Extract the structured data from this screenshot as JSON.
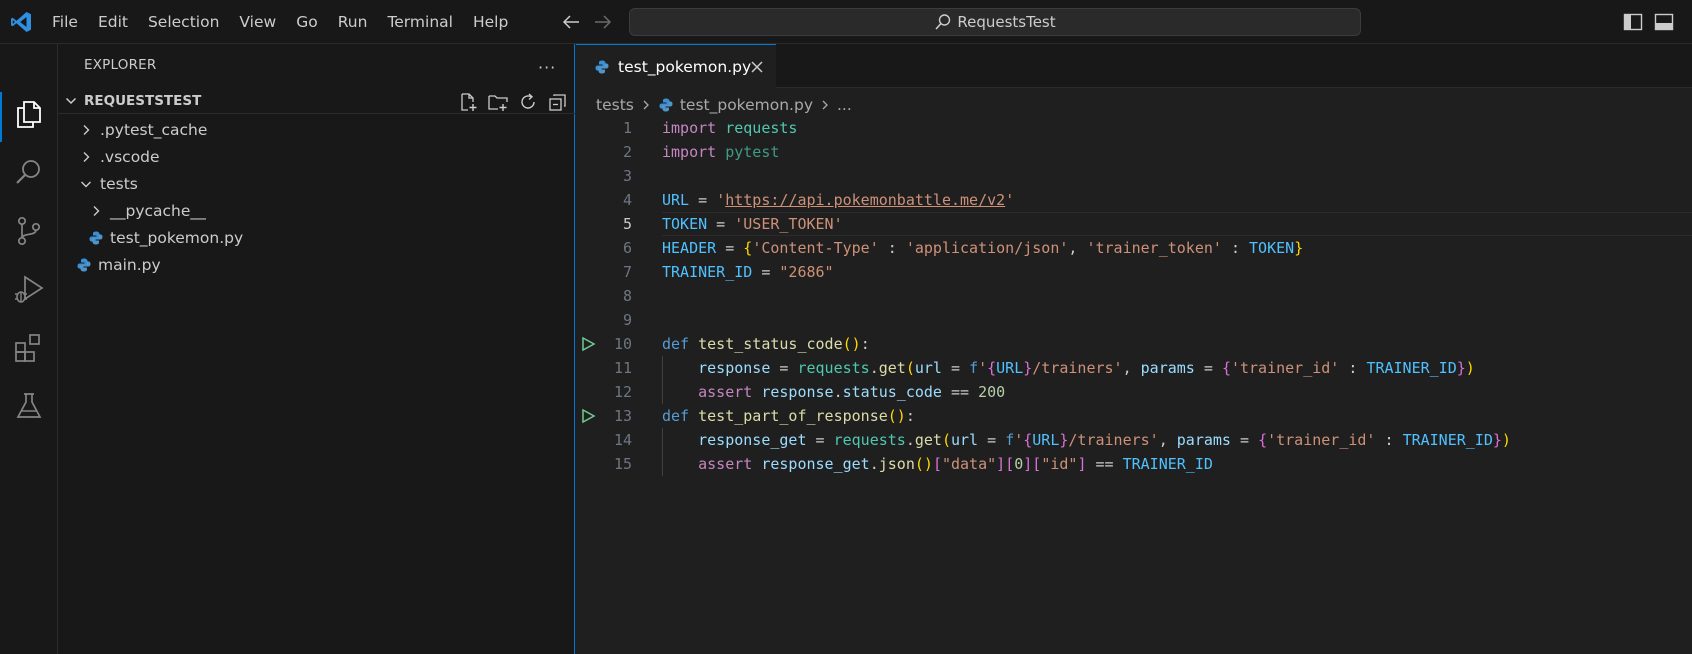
{
  "titlebar": {
    "menu": [
      "File",
      "Edit",
      "Selection",
      "View",
      "Go",
      "Run",
      "Terminal",
      "Help"
    ],
    "search_label": "RequestsTest"
  },
  "sidebar": {
    "title": "EXPLORER",
    "more": "···",
    "section": "REQUESTSTEST",
    "tree": [
      {
        "label": ".pytest_cache",
        "type": "folder",
        "expanded": false,
        "depth": 0
      },
      {
        "label": ".vscode",
        "type": "folder",
        "expanded": false,
        "depth": 0
      },
      {
        "label": "tests",
        "type": "folder",
        "expanded": true,
        "depth": 0
      },
      {
        "label": "__pycache__",
        "type": "folder",
        "expanded": false,
        "depth": 1
      },
      {
        "label": "test_pokemon.py",
        "type": "python-file",
        "depth": 1
      },
      {
        "label": "main.py",
        "type": "python-file",
        "depth": 0
      }
    ]
  },
  "editor": {
    "tab_label": "test_pokemon.py",
    "breadcrumb": [
      "tests",
      "test_pokemon.py",
      "..."
    ],
    "current_line": 5,
    "lines": [
      [
        [
          "kw",
          "import"
        ],
        [
          "t",
          " "
        ],
        [
          "mod",
          "requests"
        ]
      ],
      [
        [
          "kw",
          "import"
        ],
        [
          "t",
          " "
        ],
        [
          "modd",
          "pytest"
        ]
      ],
      [],
      [
        [
          "var",
          "URL"
        ],
        [
          "t",
          " = "
        ],
        [
          "str",
          "'"
        ],
        [
          "url",
          "https://api.pokemonbattle.me/v2"
        ],
        [
          "str",
          "'"
        ]
      ],
      [
        [
          "var",
          "TOKEN"
        ],
        [
          "t",
          " = "
        ],
        [
          "str",
          "'USER_TOKEN'"
        ]
      ],
      [
        [
          "var",
          "HEADER"
        ],
        [
          "t",
          " = "
        ],
        [
          "b1",
          "{"
        ],
        [
          "str",
          "'Content-Type'"
        ],
        [
          "t",
          " : "
        ],
        [
          "str",
          "'application/json'"
        ],
        [
          "t",
          ", "
        ],
        [
          "str",
          "'trainer_token'"
        ],
        [
          "t",
          " : "
        ],
        [
          "var",
          "TOKEN"
        ],
        [
          "b1",
          "}"
        ]
      ],
      [
        [
          "var",
          "TRAINER_ID"
        ],
        [
          "t",
          " = "
        ],
        [
          "str",
          "\"2686\""
        ]
      ],
      [],
      [],
      [
        [
          "def",
          "def"
        ],
        [
          "t",
          " "
        ],
        [
          "fn",
          "test_status_code"
        ],
        [
          "b1",
          "()"
        ],
        [
          "t",
          ":"
        ]
      ],
      [
        [
          "t",
          "    "
        ],
        [
          "prm",
          "response"
        ],
        [
          "t",
          " = "
        ],
        [
          "mod",
          "requests"
        ],
        [
          "t",
          "."
        ],
        [
          "fn",
          "get"
        ],
        [
          "b1",
          "("
        ],
        [
          "prm",
          "url"
        ],
        [
          "t",
          " = "
        ],
        [
          "def",
          "f"
        ],
        [
          "str",
          "'"
        ],
        [
          "b2",
          "{"
        ],
        [
          "var",
          "URL"
        ],
        [
          "b2",
          "}"
        ],
        [
          "str",
          "/trainers'"
        ],
        [
          "t",
          ", "
        ],
        [
          "prm",
          "params"
        ],
        [
          "t",
          " = "
        ],
        [
          "b2",
          "{"
        ],
        [
          "str",
          "'trainer_id'"
        ],
        [
          "t",
          " : "
        ],
        [
          "var",
          "TRAINER_ID"
        ],
        [
          "b2",
          "}"
        ],
        [
          "b1",
          ")"
        ]
      ],
      [
        [
          "t",
          "    "
        ],
        [
          "kw",
          "assert"
        ],
        [
          "t",
          " "
        ],
        [
          "prm",
          "response"
        ],
        [
          "t",
          "."
        ],
        [
          "prm",
          "status_code"
        ],
        [
          "t",
          " == "
        ],
        [
          "num",
          "200"
        ]
      ],
      [
        [
          "def",
          "def"
        ],
        [
          "t",
          " "
        ],
        [
          "fn",
          "test_part_of_response"
        ],
        [
          "b1",
          "()"
        ],
        [
          "t",
          ":"
        ]
      ],
      [
        [
          "t",
          "    "
        ],
        [
          "prm",
          "response_get"
        ],
        [
          "t",
          " = "
        ],
        [
          "mod",
          "requests"
        ],
        [
          "t",
          "."
        ],
        [
          "fn",
          "get"
        ],
        [
          "b1",
          "("
        ],
        [
          "prm",
          "url"
        ],
        [
          "t",
          " = "
        ],
        [
          "def",
          "f"
        ],
        [
          "str",
          "'"
        ],
        [
          "b2",
          "{"
        ],
        [
          "var",
          "URL"
        ],
        [
          "b2",
          "}"
        ],
        [
          "str",
          "/trainers'"
        ],
        [
          "t",
          ", "
        ],
        [
          "prm",
          "params"
        ],
        [
          "t",
          " = "
        ],
        [
          "b2",
          "{"
        ],
        [
          "str",
          "'trainer_id'"
        ],
        [
          "t",
          " : "
        ],
        [
          "var",
          "TRAINER_ID"
        ],
        [
          "b2",
          "}"
        ],
        [
          "b1",
          ")"
        ]
      ],
      [
        [
          "t",
          "    "
        ],
        [
          "kw",
          "assert"
        ],
        [
          "t",
          " "
        ],
        [
          "prm",
          "response_get"
        ],
        [
          "t",
          "."
        ],
        [
          "fn",
          "json"
        ],
        [
          "b1",
          "()"
        ],
        [
          "b2",
          "["
        ],
        [
          "str",
          "\"data\""
        ],
        [
          "b2",
          "]"
        ],
        [
          "b2",
          "["
        ],
        [
          "num",
          "0"
        ],
        [
          "b2",
          "]"
        ],
        [
          "b2",
          "["
        ],
        [
          "str",
          "\"id\""
        ],
        [
          "b2",
          "]"
        ],
        [
          "t",
          " == "
        ],
        [
          "var",
          "TRAINER_ID"
        ]
      ]
    ],
    "run_lines": [
      10,
      13
    ]
  },
  "icons": {
    "logo": "vscode-logo-icon",
    "activity": [
      "explorer-icon",
      "search-icon",
      "source-control-icon",
      "run-debug-icon",
      "extensions-icon",
      "testing-icon"
    ]
  }
}
